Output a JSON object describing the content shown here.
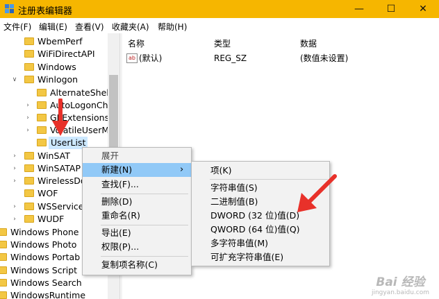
{
  "window": {
    "title": "注册表编辑器",
    "minimize_glyph": "—",
    "maximize_glyph": "☐",
    "close_glyph": "✕",
    "titlebar_color": "#f6b600"
  },
  "menubar": {
    "items": [
      "文件(F)",
      "编辑(E)",
      "查看(V)",
      "收藏夹(A)",
      "帮助(H)"
    ]
  },
  "tree": {
    "items": [
      "WbemPerf",
      "WiFiDirectAPI",
      "Windows",
      "Winlogon",
      "AlternateShel",
      "AutoLogonCh",
      "GPExtensions",
      "VolatileUserM",
      "UserList",
      "WinSAT",
      "WinSATAP",
      "WirelessDo",
      "WOF",
      "WSService",
      "WUDF",
      "Windows Phone",
      "Windows Photo",
      "Windows Portab",
      "Windows Script",
      "Windows Search",
      "WindowsRuntime"
    ],
    "selected": "UserList"
  },
  "values_pane": {
    "headers": [
      "名称",
      "类型",
      "数据"
    ],
    "rows": [
      {
        "icon": "ab",
        "name": "(默认)",
        "type": "REG_SZ",
        "data": "(数值未设置)"
      }
    ]
  },
  "context_menu": {
    "items": [
      "展开",
      "新建(N)",
      "查找(F)...",
      "删除(D)",
      "重命名(R)",
      "导出(E)",
      "权限(P)...",
      "复制项名称(C)"
    ],
    "highlighted": "新建(N)",
    "submenu_arrow": "›"
  },
  "submenu": {
    "items": [
      "项(K)",
      "字符串值(S)",
      "二进制值(B)",
      "DWORD (32 位)值(D)",
      "QWORD (64 位)值(Q)",
      "多字符串值(M)",
      "可扩充字符串值(E)"
    ]
  },
  "annotations": {
    "arrow_color": "#e8312a"
  },
  "watermark": {
    "brand": "Bai 经验",
    "url": "jingyan.baidu.com"
  }
}
